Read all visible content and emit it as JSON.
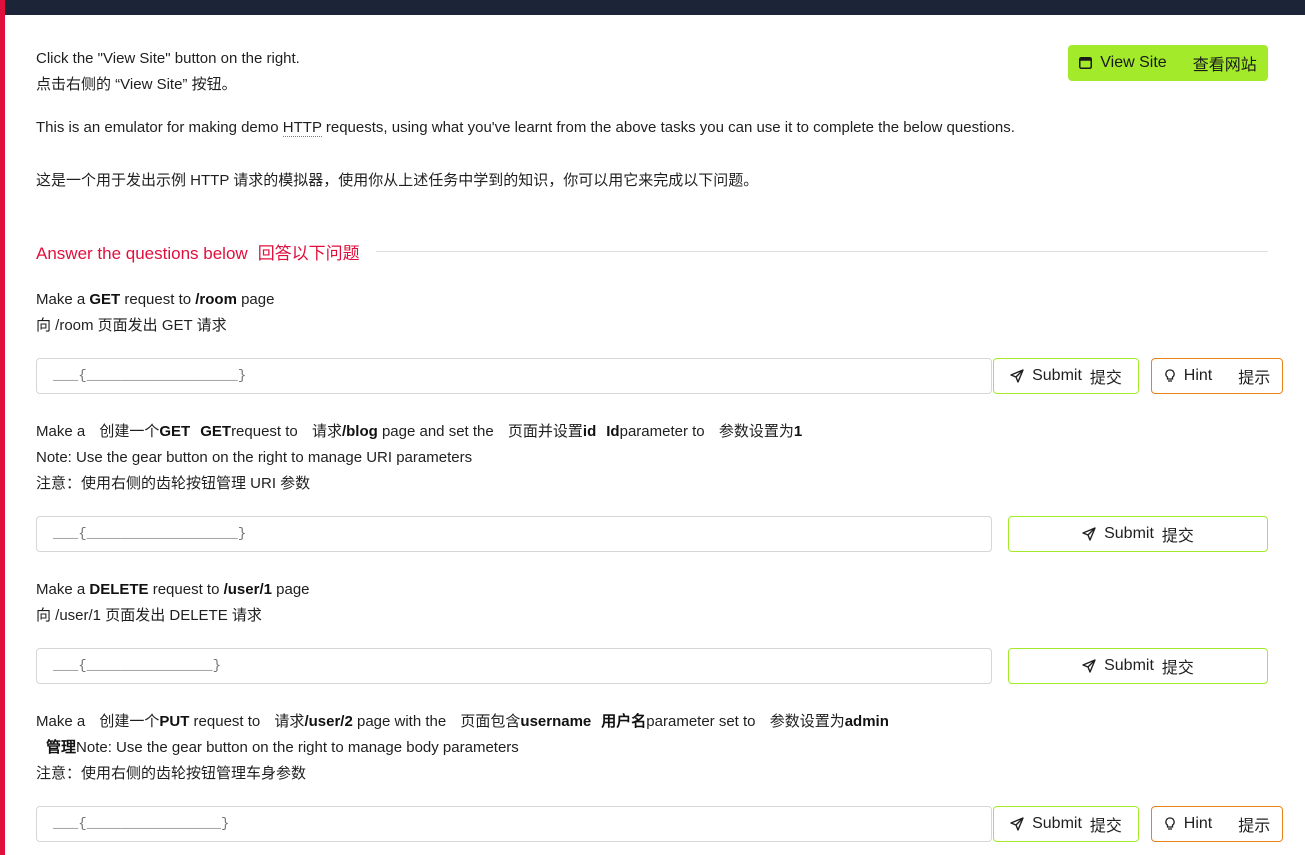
{
  "intro": {
    "line1": "Click the \"View Site\" button on the right.",
    "line2": "点击右侧的 “View Site” 按钮。",
    "desc_before": "This is an emulator for making demo ",
    "desc_abbr": "HTTP",
    "desc_after": " requests, using what you've learnt from the above tasks you can use it to complete the below questions.",
    "desc_cn": "这是一个用于发出示例 HTTP 请求的模拟器，使用你从上述任务中学到的知识，你可以用它来完成以下问题。"
  },
  "view_site": {
    "label": "View Site",
    "label_cn": "查看网站",
    "icon": "browser-window-icon"
  },
  "section": {
    "title": "Answer the questions below",
    "title_cn": "回答以下问题"
  },
  "questions": [
    {
      "t1": "Make a ",
      "b1": "GET",
      "t2": " request to ",
      "b2": "/room",
      "t3": " page",
      "cn": "向 /room 页面发出 GET 请求",
      "placeholder": "___{__________________}"
    },
    {
      "t1": "Make a ",
      "t1cn": "创建一个",
      "b1": "GET",
      "b1cn": "GET",
      "t2": "request to ",
      "t2cn": "请求",
      "b2": "/blog",
      "t3": " page and set the ",
      "t3cn": "页面并设置",
      "b3": "id",
      "b3cn": "Id",
      "t4": "parameter to ",
      "t4cn": "参数设置为",
      "b4": "1",
      "note": "Note: Use the gear button on the right to manage URI parameters",
      "note_cn": "注意：使用右侧的齿轮按钮管理 URI 参数",
      "placeholder": "___{__________________}"
    },
    {
      "t1": "Make a ",
      "b1": "DELETE",
      "t2": " request to ",
      "b2": "/user/1",
      "t3": " page",
      "cn": "向 /user/1 页面发出 DELETE 请求",
      "placeholder": "___{_______________}"
    },
    {
      "t1": "Make a ",
      "t1cn": "创建一个",
      "b1": "PUT",
      "t2": " request to ",
      "t2cn": "请求",
      "b2": "/user/2",
      "t3": " page with the ",
      "t3cn": "页面包含",
      "b3": "username",
      "b3cn": "用户名",
      "t4": "parameter set to ",
      "t4cn": "参数设置为",
      "b4": "admin",
      "b4cn": "管理",
      "note": "Note: Use the gear button on the right to manage body parameters",
      "note_cn": "注意：使用右侧的齿轮按钮管理车身参数",
      "placeholder": "___{________________}"
    }
  ],
  "buttons": {
    "submit": "Submit",
    "submit_cn": "提交",
    "hint": "Hint",
    "hint_cn": "提示"
  }
}
